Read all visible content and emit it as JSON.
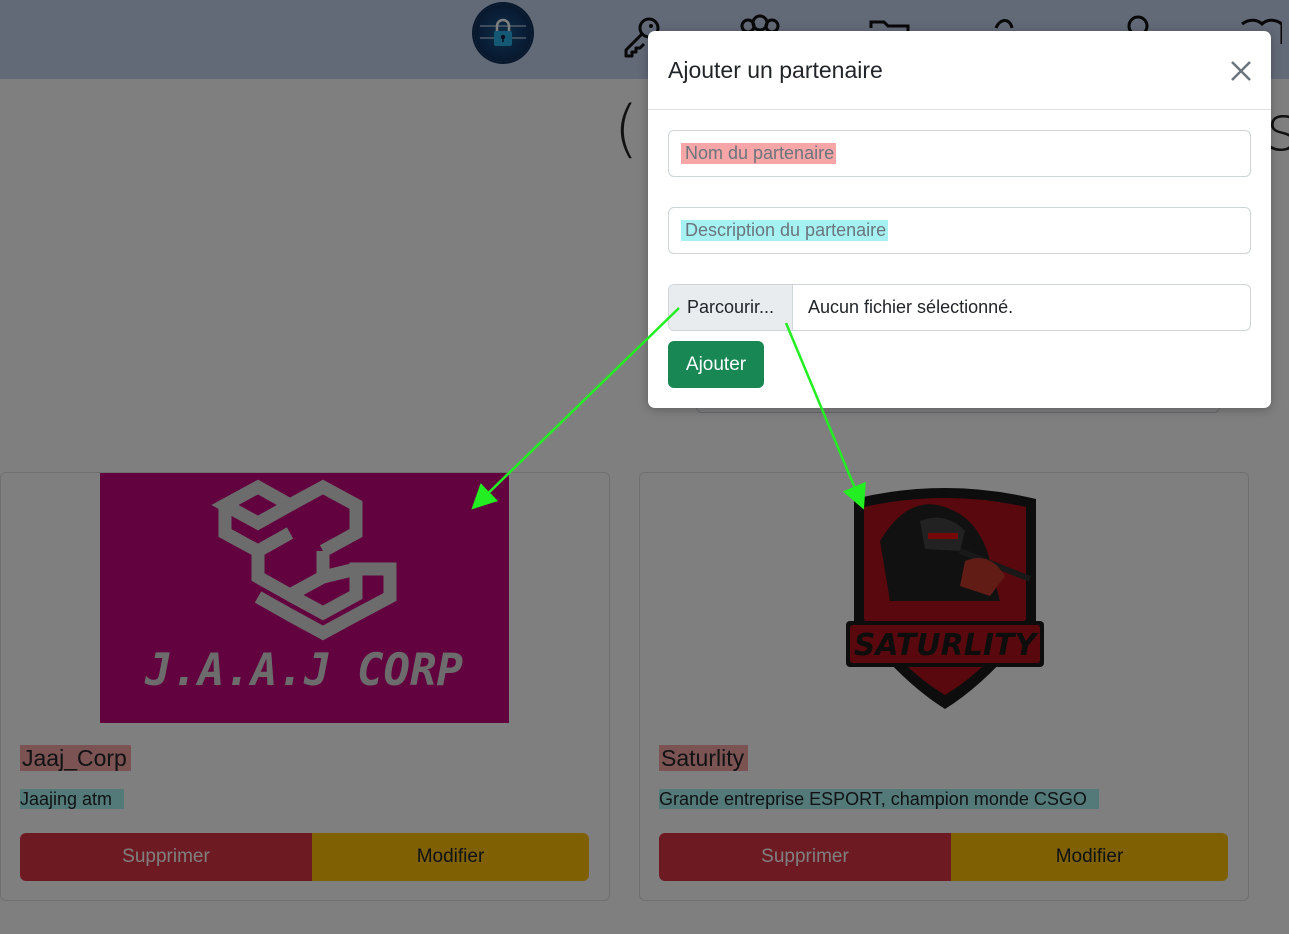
{
  "navbar": {
    "logo": "padlock-logo",
    "icons": [
      "key-icon",
      "users-icon",
      "folder-icon",
      "brush-icon",
      "user-icon",
      "book-icon"
    ]
  },
  "page": {
    "title_fragment_left": "(",
    "title_fragment_right": "s"
  },
  "partners": [
    {
      "name": "Jaaj_Corp",
      "description": "Jaajing atm",
      "logo_text": "J.A.A.J CORP",
      "logo_bg": "#c4057f",
      "delete_label": "Supprimer",
      "edit_label": "Modifier"
    },
    {
      "name": "Saturlity",
      "description": "Grande entreprise ESPORT, champion monde CSGO",
      "logo_text": "SATURLITY",
      "logo_bg": "#b3121a",
      "delete_label": "Supprimer",
      "edit_label": "Modifier"
    }
  ],
  "modal": {
    "title": "Ajouter un partenaire",
    "name_placeholder": "Nom du partenaire",
    "description_placeholder": "Description du partenaire",
    "file_button_label": "Parcourir...",
    "file_status": "Aucun fichier sélectionné.",
    "submit_label": "Ajouter"
  },
  "colors": {
    "danger": "#dc3545",
    "warning": "#ffc107",
    "success": "#198754",
    "annotation_arrow": "#22ee22"
  }
}
